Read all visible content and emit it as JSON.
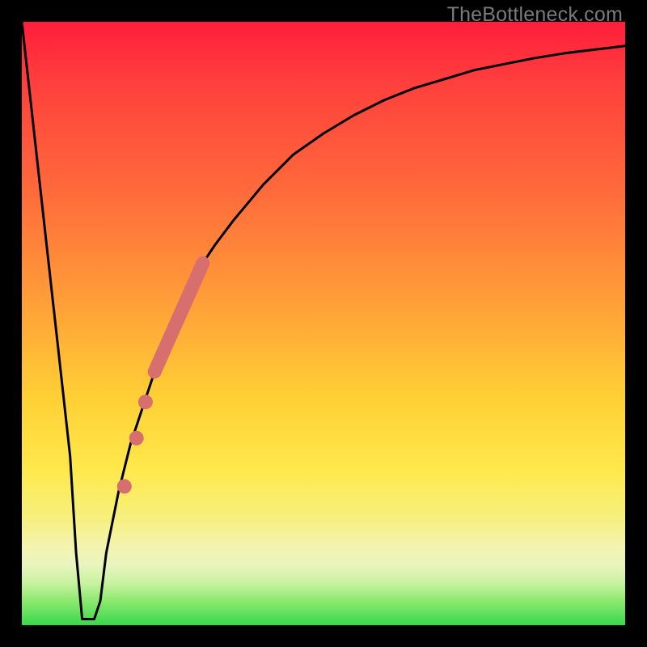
{
  "watermark": "TheBottleneck.com",
  "chart_data": {
    "type": "line",
    "title": "",
    "xlabel": "",
    "ylabel": "",
    "xlim": [
      0,
      100
    ],
    "ylim": [
      0,
      100
    ],
    "grid": false,
    "series": [
      {
        "name": "bottleneck-curve",
        "color": "#000000",
        "x": [
          0,
          2,
          4,
          6,
          8,
          9,
          10,
          11,
          12,
          13,
          14,
          16,
          18,
          20,
          22,
          24,
          26,
          28,
          30,
          32,
          35,
          40,
          45,
          50,
          55,
          60,
          65,
          70,
          75,
          80,
          85,
          90,
          95,
          100
        ],
        "y": [
          100,
          82,
          64,
          46,
          28,
          12,
          1,
          1,
          1,
          4,
          12,
          22,
          30,
          36,
          42,
          47,
          52,
          56,
          60,
          63,
          67,
          73,
          78,
          81.5,
          84.5,
          87,
          89,
          90.5,
          92,
          93,
          94,
          94.8,
          95.4,
          96
        ]
      }
    ],
    "highlights": [
      {
        "name": "thick-segment",
        "color": "#d76f6f",
        "shape": "thick-line",
        "x": [
          22,
          30
        ],
        "y": [
          42,
          60
        ]
      },
      {
        "name": "dot-1",
        "color": "#d76f6f",
        "shape": "circle",
        "x": 20.5,
        "y": 37
      },
      {
        "name": "dot-2",
        "color": "#d76f6f",
        "shape": "circle",
        "x": 19,
        "y": 31
      },
      {
        "name": "dot-3",
        "color": "#d76f6f",
        "shape": "circle",
        "x": 17,
        "y": 23
      }
    ]
  }
}
